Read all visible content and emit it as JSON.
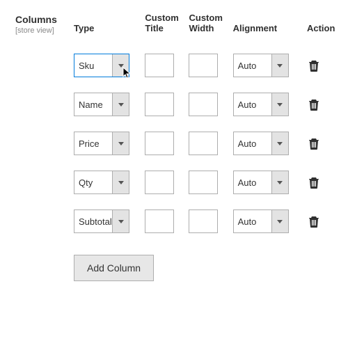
{
  "section": {
    "title": "Columns",
    "scope": "[store view]"
  },
  "headers": {
    "type": "Type",
    "custom_title": "Custom Title",
    "custom_width": "Custom Width",
    "alignment": "Alignment",
    "action": "Action"
  },
  "rows": [
    {
      "type": "Sku",
      "custom_title": "",
      "custom_width": "",
      "alignment": "Auto",
      "focused": true
    },
    {
      "type": "Name",
      "custom_title": "",
      "custom_width": "",
      "alignment": "Auto",
      "focused": false
    },
    {
      "type": "Price",
      "custom_title": "",
      "custom_width": "",
      "alignment": "Auto",
      "focused": false
    },
    {
      "type": "Qty",
      "custom_title": "",
      "custom_width": "",
      "alignment": "Auto",
      "focused": false
    },
    {
      "type": "Subtotal",
      "custom_title": "",
      "custom_width": "",
      "alignment": "Auto",
      "focused": false
    }
  ],
  "buttons": {
    "add_column": "Add Column"
  }
}
